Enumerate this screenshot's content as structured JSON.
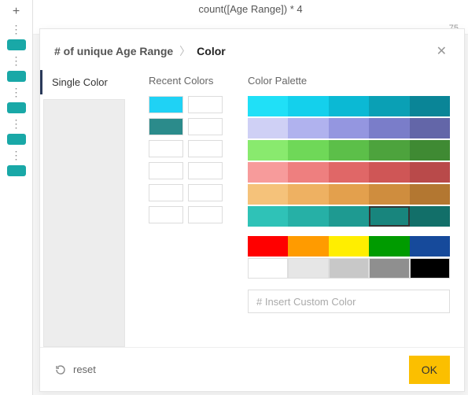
{
  "sidebar": {
    "pill_color": "#19a8a7"
  },
  "background": {
    "formula": "count([Age Range]) * 4",
    "axis_tick": "75"
  },
  "dialog": {
    "breadcrumb_first": "# of unique Age Range",
    "breadcrumb_last": "Color",
    "tab_single": "Single Color",
    "recent_title": "Recent Colors",
    "palette_title": "Color Palette",
    "recent": [
      [
        "#1fd2f5",
        "#ffffff"
      ],
      [
        "#2b8b8b",
        "#ffffff"
      ],
      [
        "#ffffff",
        "#ffffff"
      ],
      [
        "#ffffff",
        "#ffffff"
      ],
      [
        "#ffffff",
        "#ffffff"
      ],
      [
        "#ffffff",
        "#ffffff"
      ]
    ],
    "palette_rows": [
      [
        "#20e0f7",
        "#14d0ec",
        "#0bb9d4",
        "#0aa0b5",
        "#0a8597"
      ],
      [
        "#cfd0f5",
        "#b0b2ee",
        "#9496e0",
        "#7a7dc9",
        "#6366a8"
      ],
      [
        "#89ea6e",
        "#6fd858",
        "#5cbf49",
        "#4da33d",
        "#3f8a33"
      ],
      [
        "#f79b9b",
        "#ee7f7f",
        "#e06767",
        "#cf5656",
        "#b94a4a"
      ],
      [
        "#f5c27a",
        "#eeb162",
        "#e3a04d",
        "#cf8d3e",
        "#b37731"
      ],
      [
        "#2fc2b7",
        "#26b0a6",
        "#1e9a91",
        "#18857d",
        "#126f69"
      ]
    ],
    "selected_palette": {
      "row": 5,
      "col": 3
    },
    "basic_rows": [
      [
        "#ff0000",
        "#ff9b00",
        "#ffee00",
        "#009b00",
        "#164a9b"
      ],
      [
        "#ffffff",
        "#e6e6e6",
        "#c8c8c8",
        "#8f8f8f",
        "#000000"
      ]
    ],
    "custom_placeholder": "# Insert Custom Color",
    "reset_label": "reset",
    "ok_label": "OK"
  }
}
